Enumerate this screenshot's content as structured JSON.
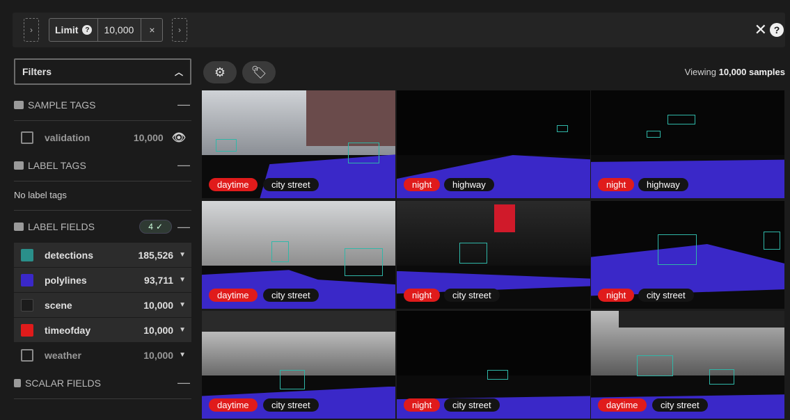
{
  "toolbar": {
    "stage_label": "Limit",
    "stage_value": "10,000",
    "help_glyph": "?",
    "clear_glyph": "×",
    "close_glyph": "✕"
  },
  "sidebar": {
    "filters_label": "Filters",
    "sample_tags_title": "SAMPLE TAGS",
    "sample_tags": [
      {
        "name": "validation",
        "count": "10,000"
      }
    ],
    "label_tags_title": "LABEL TAGS",
    "no_label_tags": "No label tags",
    "label_fields_title": "LABEL FIELDS",
    "label_fields_badge": "4",
    "label_fields": [
      {
        "name": "detections",
        "count": "185,526",
        "checked": true,
        "color": "#2a8f8a"
      },
      {
        "name": "polylines",
        "count": "93,711",
        "checked": true,
        "color": "#3a28c8"
      },
      {
        "name": "scene",
        "count": "10,000",
        "checked": true,
        "color": "#1c1c1c"
      },
      {
        "name": "timeofday",
        "count": "10,000",
        "checked": true,
        "color": "#e01b1b"
      },
      {
        "name": "weather",
        "count": "10,000",
        "checked": false,
        "color": ""
      }
    ],
    "scalar_fields_title": "SCALAR FIELDS"
  },
  "main": {
    "viewing_prefix": "Viewing",
    "viewing_count": "10,000 samples",
    "samples": [
      {
        "timeofday": "daytime",
        "scene": "city street"
      },
      {
        "timeofday": "night",
        "scene": "highway"
      },
      {
        "timeofday": "night",
        "scene": "highway"
      },
      {
        "timeofday": "daytime",
        "scene": "city street"
      },
      {
        "timeofday": "night",
        "scene": "city street"
      },
      {
        "timeofday": "night",
        "scene": "city street"
      },
      {
        "timeofday": "daytime",
        "scene": "city street"
      },
      {
        "timeofday": "night",
        "scene": "city street"
      },
      {
        "timeofday": "daytime",
        "scene": "city street"
      }
    ]
  },
  "colors": {
    "accent_red": "#e01b1b",
    "polyline_blue": "#3a28c8",
    "detection_teal": "#2fb7a8"
  }
}
